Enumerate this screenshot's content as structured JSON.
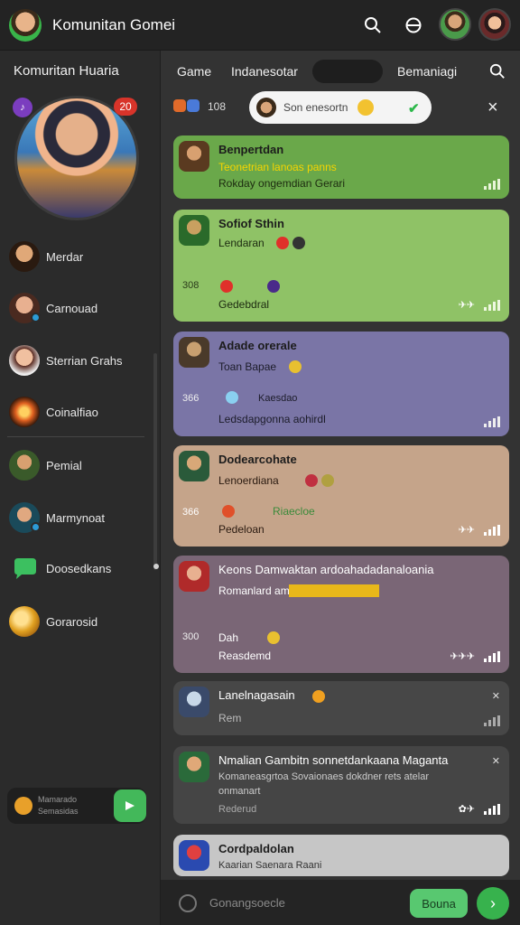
{
  "header": {
    "title": "Komunitan Gomei",
    "icons": [
      "search-icon",
      "theme-icon"
    ]
  },
  "sidebar": {
    "title": "Komuritan Huaria",
    "hero_badge_left": "♪",
    "hero_badge_right": "20",
    "items": [
      {
        "label": "Merdar"
      },
      {
        "label": "Carnouad"
      },
      {
        "label": "Sterrian Grahs"
      },
      {
        "label": "Coinalfiao"
      },
      {
        "label": "Pemial"
      },
      {
        "label": "Marmynoat"
      },
      {
        "label": "Doosedkans"
      },
      {
        "label": "Gorarosid"
      }
    ],
    "mini_card": {
      "text": "Mamarado Semasidas"
    }
  },
  "tabs": {
    "items": [
      "Game",
      "Indanesotar",
      "",
      "Bemaniagi"
    ]
  },
  "filter": {
    "count": "108",
    "search_text": "Son enesortn",
    "close": "×"
  },
  "cards": [
    {
      "name": "Benpertdan",
      "sub1": "Teonetrian lanoas panns",
      "sub2": "Rokday ongemdian Gerari",
      "num": "",
      "extra": "",
      "bg": "#6aa84a"
    },
    {
      "name": "Sofiof Sthin",
      "sub1": "Lendaran",
      "sub2": "Gedebdral",
      "num": "308",
      "extra": "",
      "bg": "#8fc266"
    },
    {
      "name": "Adade orerale",
      "sub1": "Toan Bapae",
      "sub2": "Ledsdapgonna aohirdl",
      "num": "366",
      "extra": "Kaesdao",
      "bg": "#7a75a6"
    },
    {
      "name": "Dodearcohate",
      "sub1": "Lenoerdiana",
      "sub2": "Pedeloan",
      "num": "366",
      "extra": "Riaecloe",
      "bg": "#c5a48a"
    },
    {
      "name": "Keons Damwaktan ardoahadadanaloania",
      "sub1": "Romanlard am",
      "sub2": "Reasdemd",
      "num": "300",
      "extra": "Dah",
      "bg": "#7a6676"
    },
    {
      "name": "Lanelnagasain",
      "sub1": "Rem",
      "sub2": "",
      "num": "",
      "extra": "",
      "bg": "#474747"
    },
    {
      "name": "Nmalian Gambitn sonnetdankaana Maganta",
      "sub1": "Komaneasgrtoa Sovaionaes dokdner rets atelar",
      "sub2": "onmanart",
      "num": "",
      "extra": "Rederud",
      "bg": "#454545"
    },
    {
      "name": "Cordpaldolan",
      "sub1": "Kaarian Saenara Raani",
      "sub2": "",
      "num": "",
      "extra": "",
      "bg": "#c6c6c6"
    }
  ],
  "composer": {
    "placeholder": "Gonangsoecle",
    "button_label": "Bouna",
    "send": "›"
  }
}
